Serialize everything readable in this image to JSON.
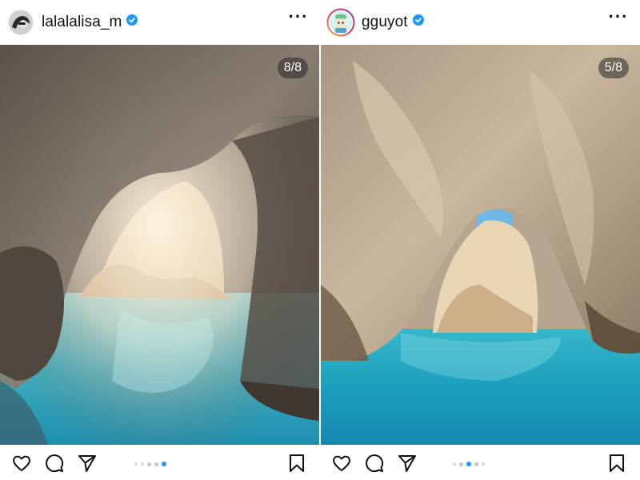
{
  "posts": [
    {
      "username": "lalalalisa_m",
      "verified": true,
      "more_label": "···",
      "image_counter": "8/8",
      "image_subject": "sea cave arch with turquoise water",
      "carousel": {
        "current": 8,
        "total": 8
      },
      "icons": [
        "heart-icon",
        "comment-icon",
        "share-icon",
        "bookmark-icon"
      ]
    },
    {
      "username": "gguyot",
      "verified": true,
      "more_label": "···",
      "image_counter": "5/8",
      "image_subject": "rock arch over turquoise sea",
      "carousel": {
        "current": 5,
        "total": 8
      },
      "icons": [
        "heart-icon",
        "comment-icon",
        "share-icon",
        "bookmark-icon"
      ]
    }
  ],
  "colors": {
    "verified_blue": "#1f96f2",
    "active_dot": "#1f96f2",
    "water": "#2fb3c4",
    "rock": "#b89a72"
  }
}
